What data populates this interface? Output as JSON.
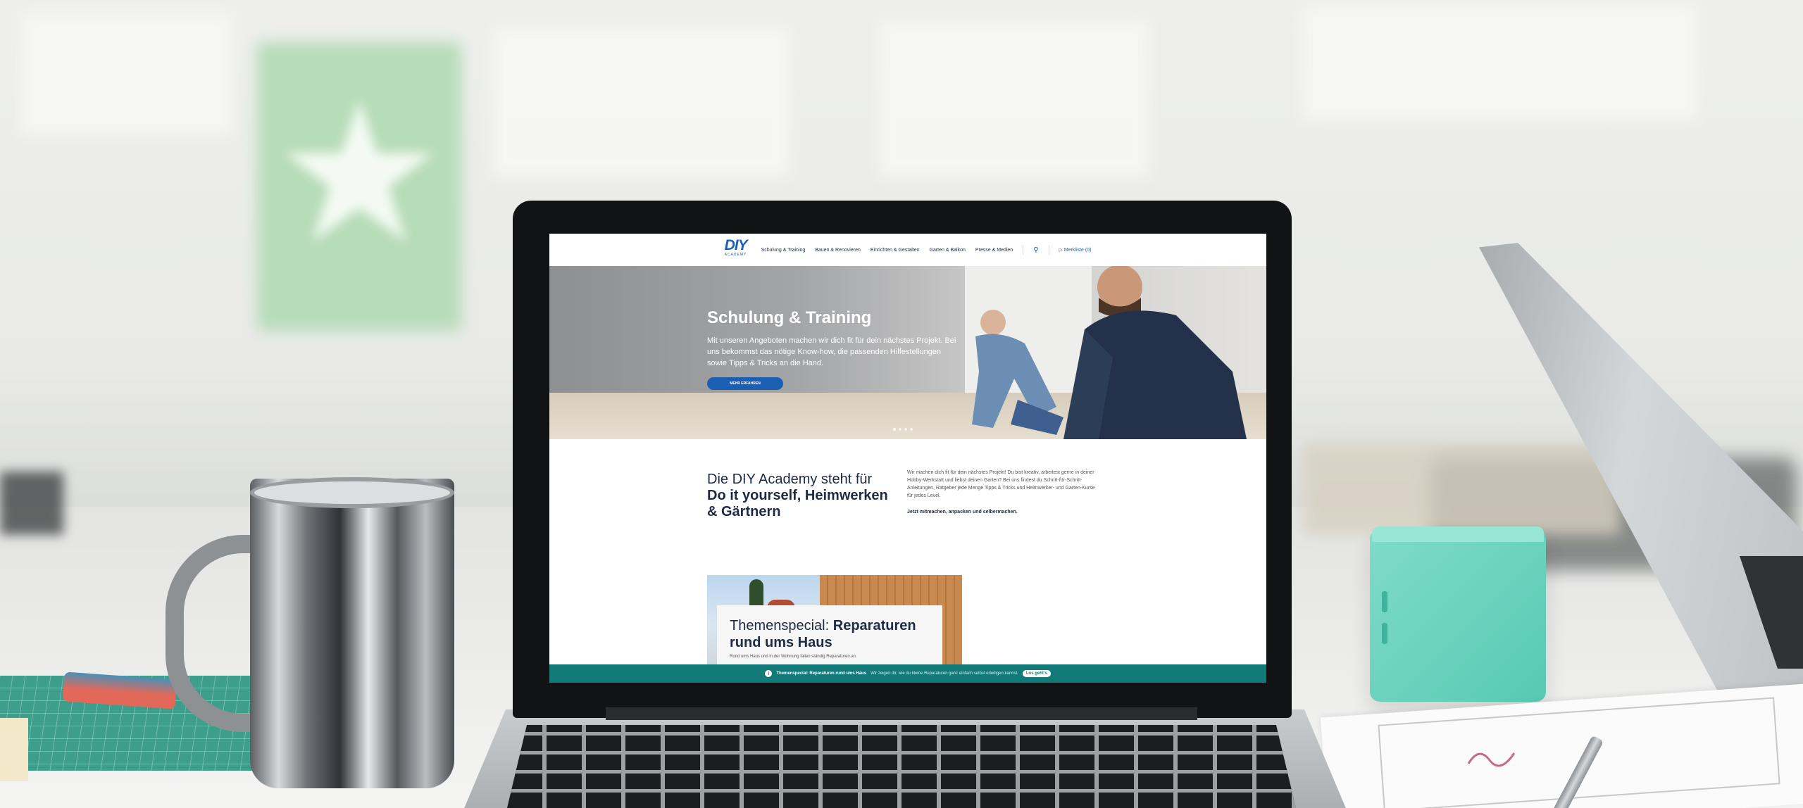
{
  "site": {
    "logo": {
      "text": "DIY",
      "subtext": "ACADEMY"
    },
    "nav": {
      "items": [
        "Schulung & Training",
        "Bauen & Renovieren",
        "Einrichten & Gestalten",
        "Garten & Balkon",
        "Presse & Medien"
      ],
      "search_icon": "search-icon",
      "bookmark_label": "Merkliste (0)",
      "bookmark_icon": "bookmark-icon"
    },
    "hero": {
      "title": "Schulung & Training",
      "text": "Mit unseren Angeboten machen wir dich fit für dein nächstes Projekt. Bei uns bekommst das nötige Know-how, die passenden Hilfestellungen sowie Tipps & Tricks an die Hand.",
      "button_label": "MEHR ERFAHREN",
      "slides": 4
    },
    "intro": {
      "heading_light": "Die DIY Academy steht für",
      "heading_bold": "Do it yourself, Heimwerken & Gärtnern",
      "paragraph": "Wir machen dich fit für dein nächstes Projekt! Du bist kreativ, arbeitest gerne in deiner Hobby-Werkstatt und liebst deinen Garten? Bei uns findest du Schritt-für-Schritt-Anleitungen, Ratgeber jede Menge Tipps & Tricks und Heimwerker- und Garten-Kurse für jedes Level.",
      "tagline": "Jetzt mitmachen, anpacken und selbermachen."
    },
    "special": {
      "title_light": "Themenspecial:",
      "title_bold": "Reparaturen rund ums Haus",
      "text": "Rund ums Haus und in der Wohnung fallen ständig Reparaturen an."
    },
    "banner": {
      "bold": "Themenspecial: Reparaturen rund ums Haus",
      "text": "Wir zeigen dir, wie du kleine Reparaturen ganz einfach selbst erledigen kannst.",
      "button": "Los geht's"
    }
  },
  "scene_colors": {
    "brand_blue": "#1a5fb4",
    "teal_banner": "#137a7a",
    "speaker": "#58c9b3"
  }
}
